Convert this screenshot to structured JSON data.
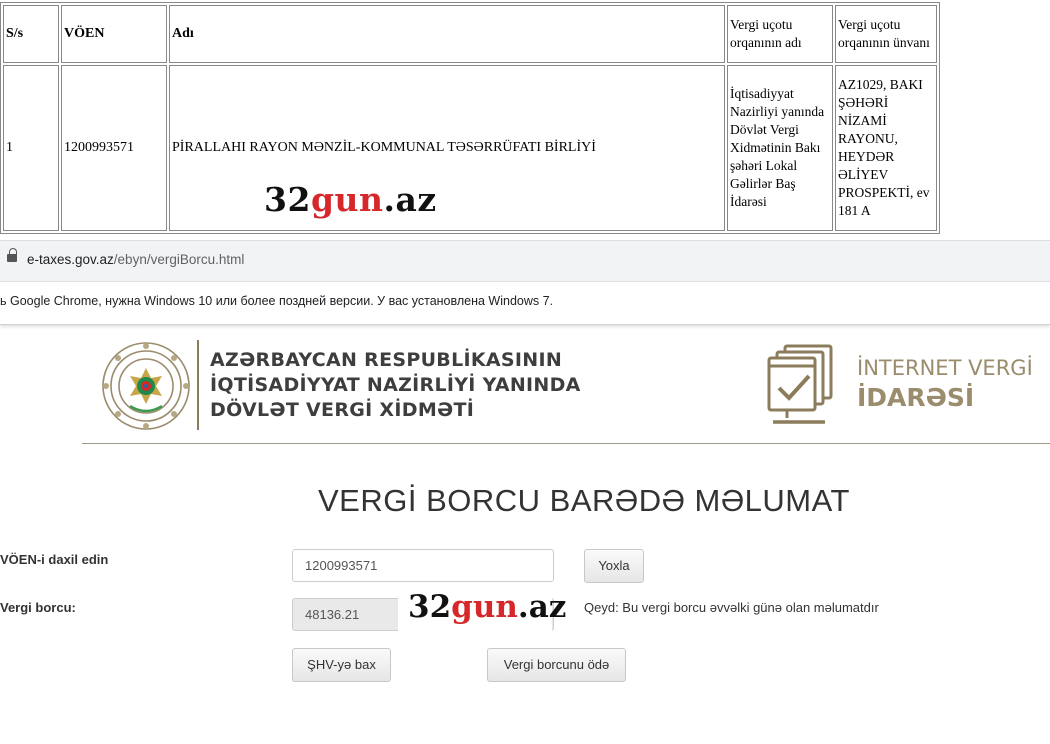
{
  "table": {
    "headers": [
      "S/s",
      "VÖEN",
      "Adı",
      "Vergi uçotu orqanının adı",
      "Vergi uçotu orqanının ünvanı"
    ],
    "rows": [
      {
        "ss": "1",
        "voen": "1200993571",
        "name": "PİRALLAHI RAYON MƏNZİL-KOMMUNAL TƏSƏRRÜFATI BİRLİYİ",
        "tax_office": "İqtisadiyyat Nazirliyi yanında Dövlət Vergi Xidmətinin Bakı şəhəri Lokal Gəlirlər Baş İdarəsi",
        "address": "AZ1029, BAKI ŞƏHƏRİ NİZAMİ RAYONU, HEYDƏR ƏLİYEV PROSPEKTİ, ev 181 A"
      }
    ]
  },
  "watermark": {
    "part1": "32",
    "part2": "gun",
    "part3": ".az",
    "accent": "#d6282b"
  },
  "browser": {
    "url_domain": "e-taxes.gov.az",
    "url_path": "/ebyn/vergiBorcu.html",
    "info_text": "ь Google Chrome, нужна Windows 10 или более поздней версии. У вас установлена Windows 7."
  },
  "header": {
    "org_lines": [
      "AZƏRBAYCAN RESPUBLİKASININ",
      "İQTİSADİYYAT NAZİRLİYİ YANINDA",
      "DÖVLƏT VERGİ XİDMƏTİ"
    ],
    "service_line1": "İNTERNET VERGİ",
    "service_line2": "İDARƏSİ",
    "brand_color": "#9a8c6c"
  },
  "form": {
    "title": "VERGİ BORCU BARƏDƏ MƏLUMAT",
    "voen_label": "VÖEN-i daxil edin",
    "voen_value": "1200993571",
    "check_button": "Yoxla",
    "debt_label": "Vergi borcu:",
    "debt_value": "48136.21",
    "note": "Qeyd: Bu vergi borcu əvvəlki günə olan məlumatdır",
    "shv_button": "ŞHV-yə bax",
    "pay_button": "Vergi borcunu ödə"
  }
}
